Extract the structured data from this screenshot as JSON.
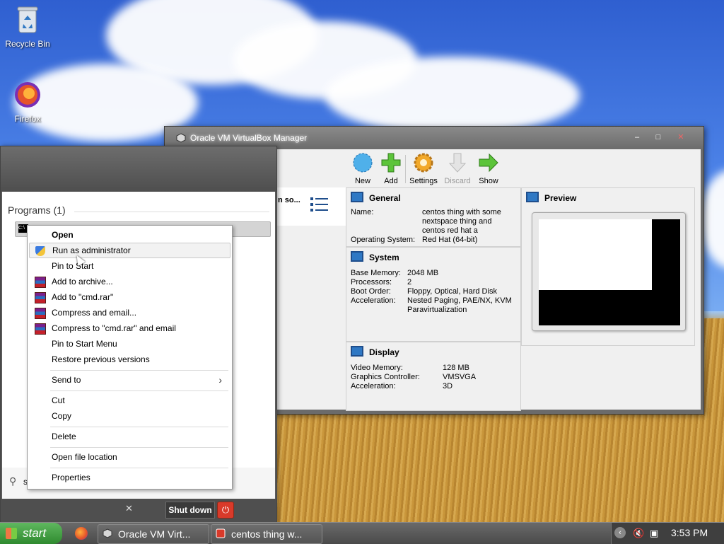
{
  "desktop": {
    "icons": [
      {
        "label": "Recycle Bin",
        "icon": "recycle-bin-icon"
      },
      {
        "label": "Firefox",
        "icon": "firefox-icon"
      }
    ]
  },
  "vbox": {
    "title": "Oracle VM VirtualBox Manager",
    "toolbar": {
      "new": "New",
      "add": "Add",
      "settings": "Settings",
      "discard": "Discard",
      "show": "Show"
    },
    "vm_list_item": "n so...",
    "general": {
      "heading": "General",
      "name_label": "Name:",
      "name_value": [
        "centos thing with some",
        "nextspace thing and",
        "centos red hat a"
      ],
      "os_label": "Operating System:",
      "os_value": "Red Hat (64-bit)"
    },
    "system": {
      "heading": "System",
      "rows": [
        {
          "k": "Base Memory:",
          "v": "2048 MB"
        },
        {
          "k": "Processors:",
          "v": "2"
        },
        {
          "k": "Boot Order:",
          "v": "Floppy, Optical, Hard Disk"
        },
        {
          "k": "Acceleration:",
          "v": "Nested Paging, PAE/NX, KVM"
        },
        {
          "k": "",
          "v": "Paravirtualization"
        }
      ]
    },
    "display": {
      "heading": "Display",
      "rows": [
        {
          "k": "Video Memory:",
          "v": "128 MB"
        },
        {
          "k": "Graphics Controller:",
          "v": "VMSVGA"
        },
        {
          "k": "Acceleration:",
          "v": "3D"
        }
      ]
    },
    "preview": {
      "heading": "Preview"
    }
  },
  "startmenu": {
    "programs_heading": "Programs (1)",
    "result_label": "C:\\",
    "search_text": "s",
    "shutdown_label": "Shut down"
  },
  "context_menu": {
    "items": [
      {
        "label": "Open"
      },
      {
        "label": "Run as administrator"
      },
      {
        "label": "Pin to Start"
      },
      {
        "label": "Add to archive..."
      },
      {
        "label": "Add to \"cmd.rar\""
      },
      {
        "label": "Compress and email..."
      },
      {
        "label": "Compress to \"cmd.rar\" and email"
      },
      {
        "label": "Pin to Start Menu"
      },
      {
        "label": "Restore previous versions"
      },
      {
        "label": "Send to"
      },
      {
        "label": "Cut"
      },
      {
        "label": "Copy"
      },
      {
        "label": "Delete"
      },
      {
        "label": "Open file location"
      },
      {
        "label": "Properties"
      }
    ]
  },
  "taskbar": {
    "start_label": "start",
    "tasks": [
      {
        "label": "Oracle VM Virt..."
      },
      {
        "label": "centos thing w..."
      }
    ],
    "clock": "3:53 PM"
  }
}
